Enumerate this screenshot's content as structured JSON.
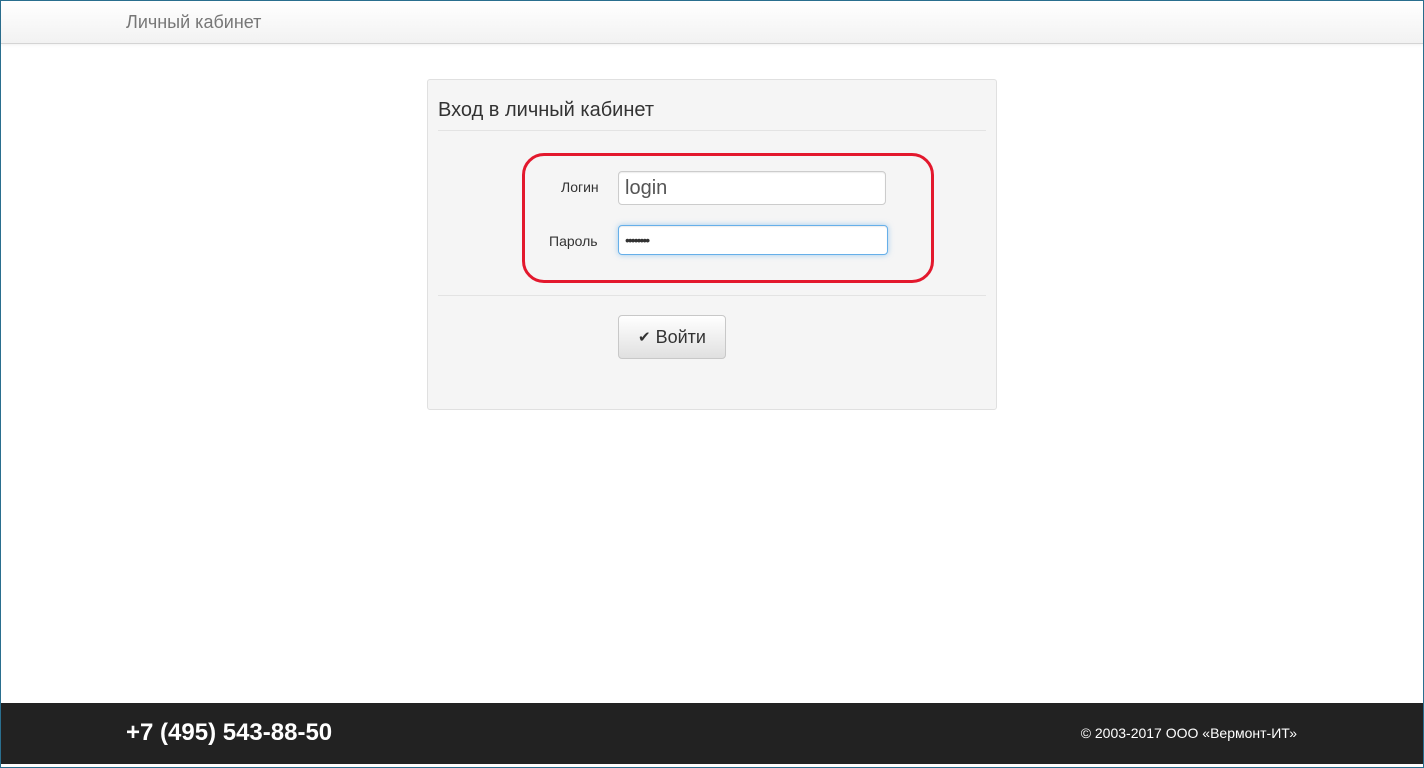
{
  "navbar": {
    "brand": "Личный кабинет"
  },
  "login_panel": {
    "title": "Вход в личный кабинет",
    "login_label": "Логин",
    "login_value": "login",
    "password_label": "Пароль",
    "password_value": "••••••••",
    "submit_label": "Войти",
    "submit_icon": "check-icon"
  },
  "footer": {
    "phone": "+7 (495) 543-88-50",
    "copyright": "© 2003-2017 ООО «Вермонт-ИТ»"
  },
  "colors": {
    "highlight": "#e3182d",
    "footer_bg": "#222222",
    "focus_border": "#66afe9"
  }
}
